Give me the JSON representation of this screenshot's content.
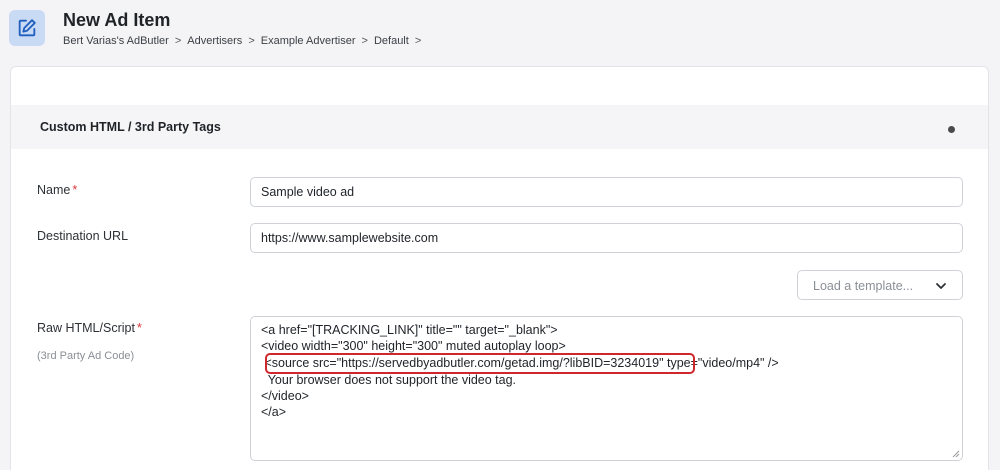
{
  "header": {
    "title": "New Ad Item",
    "icon": "edit-icon",
    "accent": "#c9daf5",
    "breadcrumb": [
      "Bert Varias's AdButler",
      "Advertisers",
      "Example Advertiser",
      "Default"
    ],
    "separator": ">"
  },
  "section": {
    "title": "Custom HTML / 3rd Party Tags"
  },
  "form": {
    "name_label": "Name",
    "name_value": "Sample video ad",
    "destination_label": "Destination URL",
    "destination_value": "https://www.samplewebsite.com",
    "template_placeholder": "Load a template...",
    "raw_label": "Raw HTML/Script",
    "raw_sublabel": "(3rd Party Ad Code)",
    "required_mark": "*",
    "code_lines": [
      "<a href=\"[TRACKING_LINK]\" title=\"\" target=\"_blank\">",
      "<video width=\"300\" height=\"300\" muted autoplay loop>",
      " <source src=\"https://servedbyadbutler.com/getad.img/?libBID=3234019\" type=\"video/mp4\" />",
      "  Your browser does not support the video tag.",
      "</video>",
      "</a>"
    ]
  },
  "colors": {
    "highlight": "#d0262d",
    "required": "#d9363e"
  }
}
